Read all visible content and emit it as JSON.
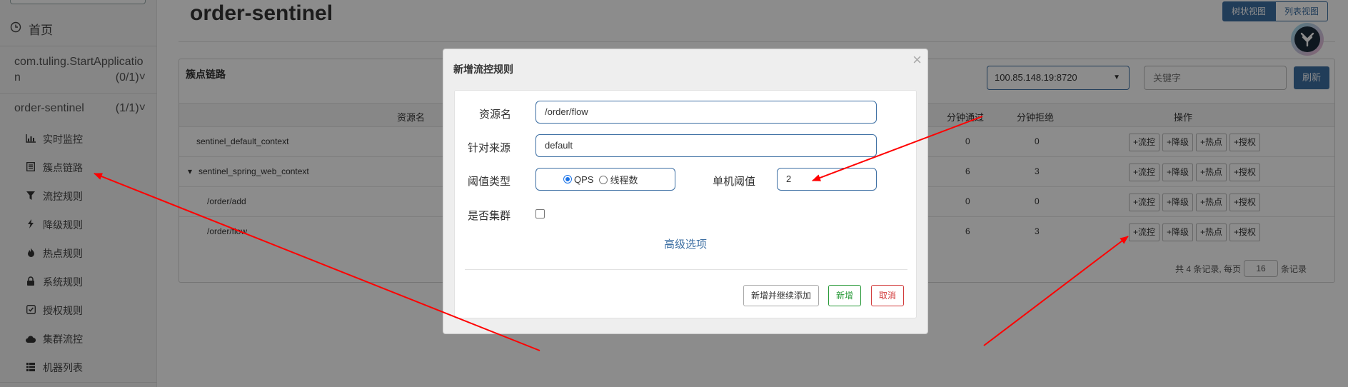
{
  "sidebar": {
    "home_label": "首页",
    "apps": [
      {
        "name_line1": "com.tuling.StartApplicatio",
        "name_line2": "n",
        "count": "(0/1)"
      },
      {
        "name_line1": "order-sentinel",
        "count": "(1/1)"
      }
    ],
    "items": [
      {
        "label": "实时监控",
        "icon": "bar-chart-icon"
      },
      {
        "label": "簇点链路",
        "icon": "list-icon"
      },
      {
        "label": "流控规则",
        "icon": "filter-icon"
      },
      {
        "label": "降级规则",
        "icon": "flash-icon"
      },
      {
        "label": "热点规则",
        "icon": "fire-icon"
      },
      {
        "label": "系统规则",
        "icon": "lock-icon"
      },
      {
        "label": "授权规则",
        "icon": "check-icon"
      },
      {
        "label": "集群流控",
        "icon": "cloud-icon"
      },
      {
        "label": "机器列表",
        "icon": "grid-icon"
      }
    ]
  },
  "header": {
    "title": "order-sentinel",
    "view_tree": "树状视图",
    "view_list": "列表视图"
  },
  "panel": {
    "title": "簇点链路",
    "ip_selected": "100.85.148.19:8720",
    "keyword_placeholder": "关键字",
    "refresh_label": "刷新",
    "columns": {
      "resource": "资源名",
      "pass": "分钟通过",
      "block": "分钟拒绝",
      "ops": "操作"
    },
    "rows": [
      {
        "name": "sentinel_default_context",
        "pass": "0",
        "block": "0"
      },
      {
        "name": "sentinel_spring_web_context",
        "pass": "6",
        "block": "3"
      },
      {
        "name": "/order/add",
        "pass": "0",
        "block": "0"
      },
      {
        "name": "/order/flow",
        "pass": "6",
        "block": "3"
      }
    ],
    "op_labels": {
      "flow": "+流控",
      "degrade": "+降级",
      "hot": "+热点",
      "auth": "+授权"
    },
    "pager": {
      "prefix": "共 4 条记录, 每页",
      "size": "16",
      "suffix": "条记录"
    }
  },
  "modal": {
    "title": "新增流控规则",
    "close": "×",
    "resource_label": "资源名",
    "resource_value": "/order/flow",
    "origin_label": "针对来源",
    "origin_value": "default",
    "threshold_type_label": "阈值类型",
    "threshold_opt_qps": "QPS",
    "threshold_opt_thread": "线程数",
    "single_threshold_label": "单机阈值",
    "single_threshold_value": "2",
    "cluster_label": "是否集群",
    "advanced_label": "高级选项",
    "btn_add_continue": "新增并继续添加",
    "btn_add": "新增",
    "btn_cancel": "取消"
  },
  "colors": {
    "primary": "#3d6fa3",
    "annotation": "#ff0000",
    "success": "#2a9a3a",
    "danger": "#d23b3b"
  }
}
